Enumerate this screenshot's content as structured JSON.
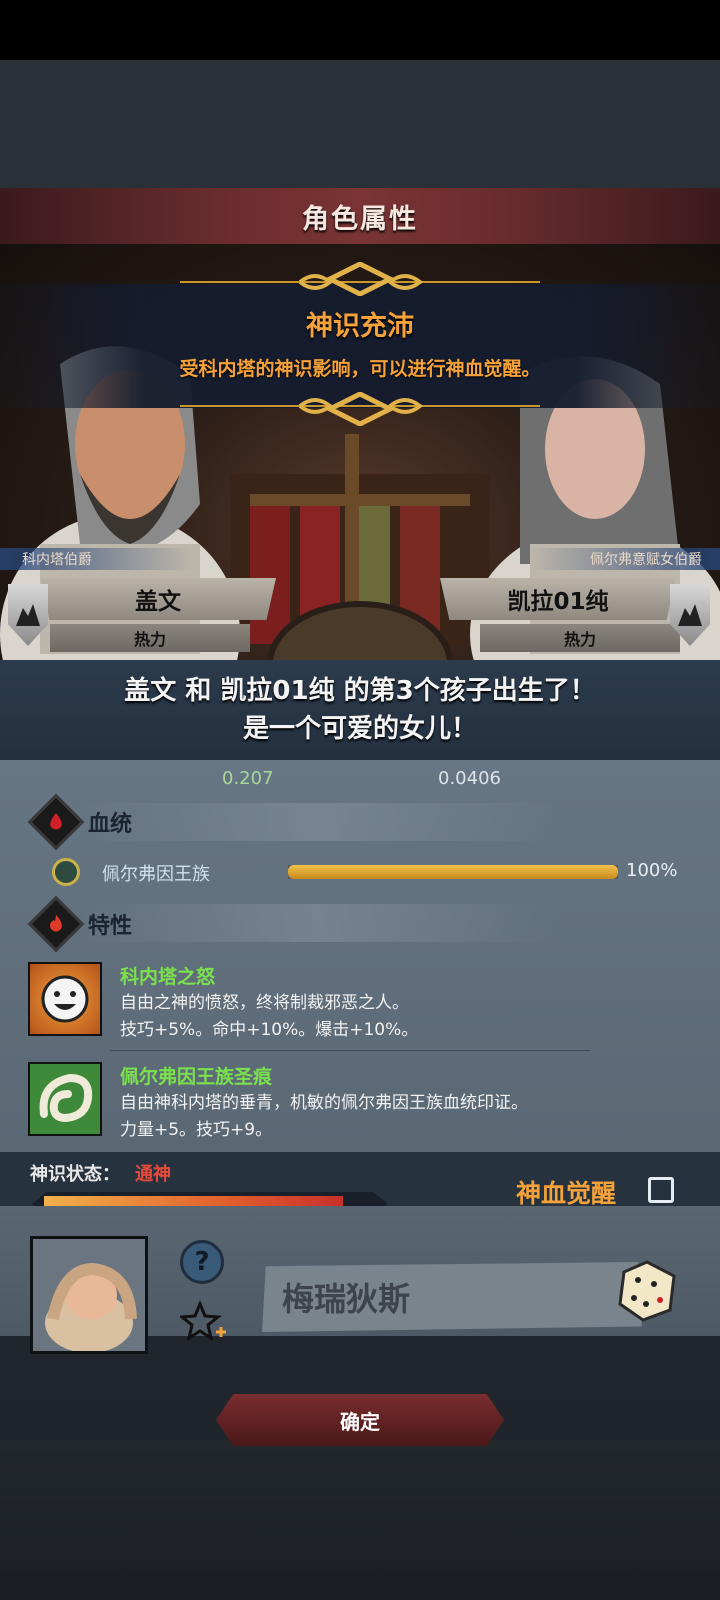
{
  "header": {
    "title": "角色属性"
  },
  "banner": {
    "title": "神识充沛",
    "description": "受科内塔的神识影响，可以进行神血觉醒。"
  },
  "father": {
    "rank_title": "科内塔伯爵",
    "name": "盖文",
    "trait": "热力"
  },
  "mother": {
    "rank_title": "佩尔弗意赋女伯爵",
    "name": "凯拉01纯",
    "trait": "热力"
  },
  "announcement": {
    "line1": "盖文 和 凯拉01纯 的第3个孩子出生了！",
    "line2": "是一个可爱的女儿！"
  },
  "stats": {
    "left": "0.207",
    "right": "0.0406"
  },
  "bloodline": {
    "header": "血统",
    "entries": [
      {
        "name": "佩尔弗因王族",
        "percent_label": "100%",
        "fill": 1.0
      }
    ]
  },
  "traits": {
    "header": "特性",
    "items": [
      {
        "name": "科内塔之怒",
        "desc1": "自由之神的愤怒，终将制裁邪恶之人。",
        "desc2": "技巧+5%。命中+10%。爆击+10%。",
        "icon": "smiley-face-icon"
      },
      {
        "name": "佩尔弗因王族圣痕",
        "desc1": "自由神科内塔的垂青，机敏的佩尔弗因王族血统印证。",
        "desc2": "力量+5。技巧+9。",
        "icon": "green-swirl-icon"
      }
    ]
  },
  "divine": {
    "state_label": "神识状态：",
    "state_value": "通神",
    "state_fill": 0.9,
    "awaken_label": "神血觉醒"
  },
  "baby": {
    "name": "梅瑞狄斯"
  },
  "confirm_label": "确定",
  "colors": {
    "accent_orange": "#f5a23a",
    "trait_green": "#7be04d",
    "state_red": "#e84a3a"
  }
}
